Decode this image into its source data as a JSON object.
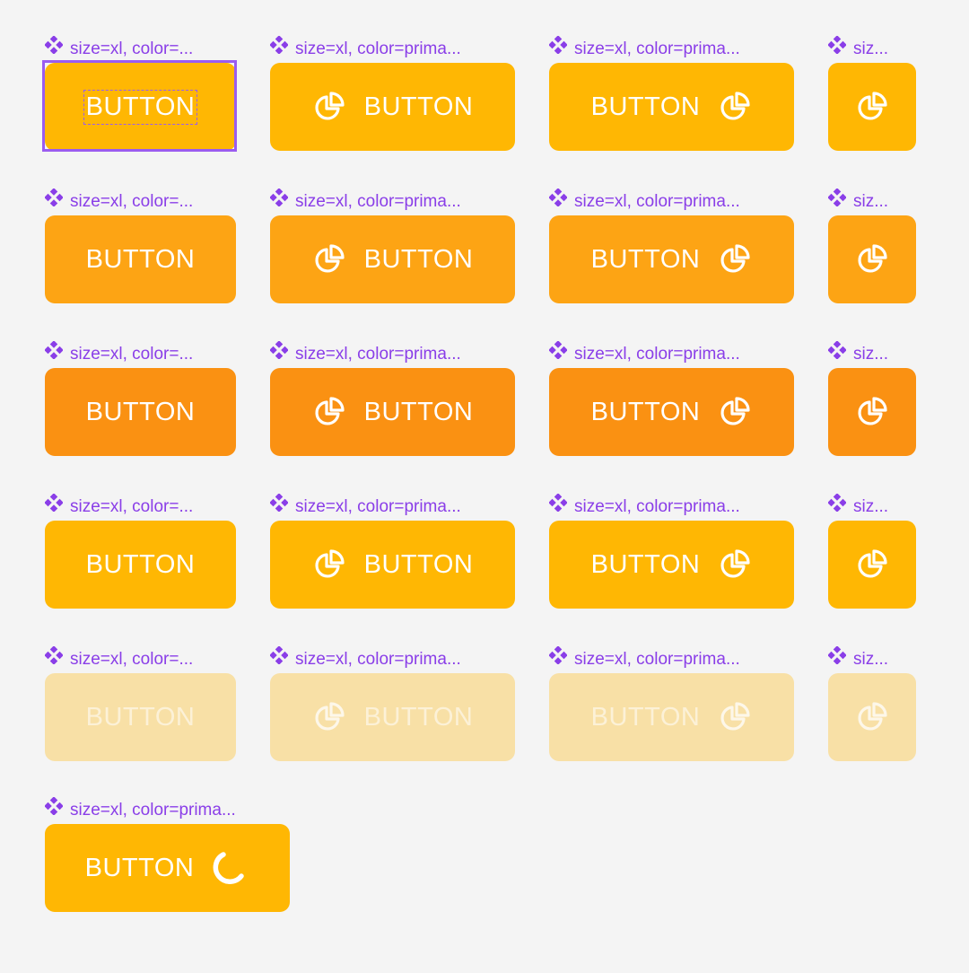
{
  "colors": {
    "default": "#ffb703",
    "hover": "#fda414",
    "pressed": "#fa9112",
    "focus": "#ffb703",
    "disabled": "#f8e0a6",
    "label": "#8a3ee8"
  },
  "button_text": "BUTTON",
  "rows": [
    {
      "state": "default",
      "labels": [
        "size=xl, color=...",
        "size=xl, color=prima...",
        "size=xl, color=prima...",
        "siz..."
      ]
    },
    {
      "state": "hover",
      "labels": [
        "size=xl, color=...",
        "size=xl, color=prima...",
        "size=xl, color=prima...",
        "siz..."
      ]
    },
    {
      "state": "pressed",
      "labels": [
        "size=xl, color=...",
        "size=xl, color=prima...",
        "size=xl, color=prima...",
        "siz..."
      ]
    },
    {
      "state": "focus",
      "labels": [
        "size=xl, color=...",
        "size=xl, color=prima...",
        "size=xl, color=prima...",
        "siz..."
      ]
    },
    {
      "state": "disabled",
      "labels": [
        "size=xl, color=...",
        "size=xl, color=prima...",
        "size=xl, color=prima...",
        "siz..."
      ]
    }
  ],
  "loading_variant": {
    "label": "size=xl, color=prima...",
    "icon": "spinner-icon"
  },
  "icons": {
    "component": "component-diamond-icon",
    "button": "pie-chart-icon"
  }
}
